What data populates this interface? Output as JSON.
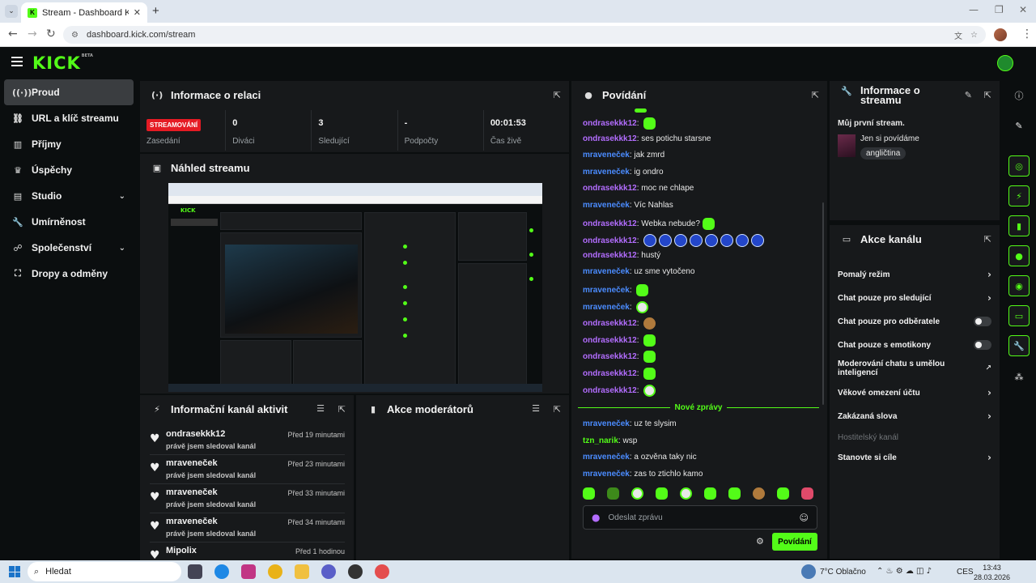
{
  "browser": {
    "tab_title": "Stream - Dashboard Kicku",
    "url": "dashboard.kick.com/stream"
  },
  "app": {
    "logo": "KICK",
    "logo_badge": "BETA"
  },
  "sidebar": {
    "items": [
      {
        "label": "Proud",
        "icon": "broadcast-icon"
      },
      {
        "label": "URL a klíč streamu",
        "icon": "link-icon"
      },
      {
        "label": "Příjmy",
        "icon": "chart-icon"
      },
      {
        "label": "Úspěchy",
        "icon": "trophy-icon"
      },
      {
        "label": "Studio",
        "icon": "studio-icon"
      },
      {
        "label": "Umírněnost",
        "icon": "wrench-icon"
      },
      {
        "label": "Společenství",
        "icon": "community-icon"
      },
      {
        "label": "Dropy a odměny",
        "icon": "gift-icon"
      }
    ]
  },
  "session": {
    "title": "Informace o relaci",
    "live_badge": "STREAMOVÁNÍ",
    "stats": [
      {
        "value": "",
        "label": "Zasedání"
      },
      {
        "value": "0",
        "label": "Diváci"
      },
      {
        "value": "3",
        "label": "Sledující"
      },
      {
        "value": "-",
        "label": "Podpočty"
      },
      {
        "value": "00:01:53",
        "label": "Čas živě"
      }
    ]
  },
  "preview": {
    "title": "Náhled streamu"
  },
  "activity": {
    "title": "Informační kanál aktivit",
    "items": [
      {
        "name": "ondrasekkk12",
        "desc": "právě jsem sledoval kanál",
        "time": "Před 19 minutami"
      },
      {
        "name": "mraveneček",
        "desc": "právě jsem sledoval kanál",
        "time": "Před 23 minutami"
      },
      {
        "name": "mraveneček",
        "desc": "právě jsem sledoval kanál",
        "time": "Před 33 minutami"
      },
      {
        "name": "mraveneček",
        "desc": "právě jsem sledoval kanál",
        "time": "Před 34 minutami"
      },
      {
        "name": "Mipolix",
        "desc": "",
        "time": "Před 1 hodinou"
      }
    ]
  },
  "moderators": {
    "title": "Akce moderátorů"
  },
  "chat": {
    "title": "Povídání",
    "messages": [
      {
        "user": "ondrasekkk12",
        "color": "purple",
        "text": "",
        "emotes": 1
      },
      {
        "user": "ondrasekkk12",
        "color": "purple",
        "text": "ses potichu starsne",
        "emotes": 0
      },
      {
        "user": "mraveneček",
        "color": "blue",
        "text": "jak zmrd",
        "emotes": 0
      },
      {
        "user": "mraveneček",
        "color": "blue",
        "text": "ig ondro",
        "emotes": 0
      },
      {
        "user": "ondrasekkk12",
        "color": "purple",
        "text": "moc ne chlape",
        "emotes": 0
      },
      {
        "user": "mraveneček",
        "color": "blue",
        "text": "Víc Nahlas",
        "emotes": 0
      },
      {
        "user": "ondrasekkk12",
        "color": "purple",
        "text": "Webka nebude?",
        "emotes": 1
      },
      {
        "user": "ondrasekkk12",
        "color": "purple",
        "text": "",
        "emotes": 8,
        "emote_style": "blue"
      },
      {
        "user": "ondrasekkk12",
        "color": "purple",
        "text": "hustý",
        "emotes": 0
      },
      {
        "user": "mraveneček",
        "color": "blue",
        "text": "uz sme vytočeno",
        "emotes": 0
      },
      {
        "user": "mraveneček",
        "color": "blue",
        "text": "",
        "emotes": 1
      },
      {
        "user": "mraveneček",
        "color": "blue",
        "text": "",
        "emotes": 1,
        "emote_style": "face"
      },
      {
        "user": "ondrasekkk12",
        "color": "purple",
        "text": "",
        "emotes": 1,
        "emote_style": "brown"
      },
      {
        "user": "ondrasekkk12",
        "color": "purple",
        "text": "",
        "emotes": 1
      },
      {
        "user": "ondrasekkk12",
        "color": "purple",
        "text": "",
        "emotes": 1
      },
      {
        "user": "ondrasekkk12",
        "color": "purple",
        "text": "",
        "emotes": 1
      },
      {
        "user": "ondrasekkk12",
        "color": "purple",
        "text": "",
        "emotes": 1,
        "emote_style": "face"
      }
    ],
    "new_messages_label": "Nové zprávy",
    "new_messages": [
      {
        "user": "mraveneček",
        "color": "blue",
        "text": "uz te slysim"
      },
      {
        "user": "tzn_narik",
        "color": "green",
        "text": "wsp"
      },
      {
        "user": "mraveneček",
        "color": "blue",
        "text": "a ozvěna taky nic"
      },
      {
        "user": "mraveneček",
        "color": "blue",
        "text": "zas to ztichlo kamo"
      }
    ],
    "input_placeholder": "Odeslat zprávu",
    "send_label": "Povídání"
  },
  "stream_info": {
    "title": "Informace o streamu",
    "stream_title": "Můj první stream.",
    "category": "Jen si povídáme",
    "language": "angličtina"
  },
  "channel_actions": {
    "title": "Akce kanálu",
    "rows": [
      {
        "label": "Pomalý režim",
        "control": "chevron"
      },
      {
        "label": "Chat pouze pro sledující",
        "control": "chevron"
      },
      {
        "label": "Chat pouze pro odběratele",
        "control": "toggle"
      },
      {
        "label": "Chat pouze s emotikony",
        "control": "toggle"
      },
      {
        "label": "Moderování chatu s umělou inteligencí",
        "control": "external"
      },
      {
        "label": "Věkové omezení účtu",
        "control": "chevron"
      },
      {
        "label": "Zakázaná slova",
        "control": "chevron"
      },
      {
        "label": "Hostitelský kanál",
        "control": "disabled"
      },
      {
        "label": "Stanovte si cíle",
        "control": "chevron"
      }
    ]
  },
  "taskbar": {
    "search_label": "Hledat",
    "weather_temp": "7°C",
    "weather_text": "Oblačno",
    "lang": "CES",
    "time": "13:43",
    "date": "28.03.2026"
  },
  "colors": {
    "accent": "#53fc18",
    "live": "#e51b24",
    "purple_user": "#b36dff",
    "blue_user": "#4b8cff"
  }
}
